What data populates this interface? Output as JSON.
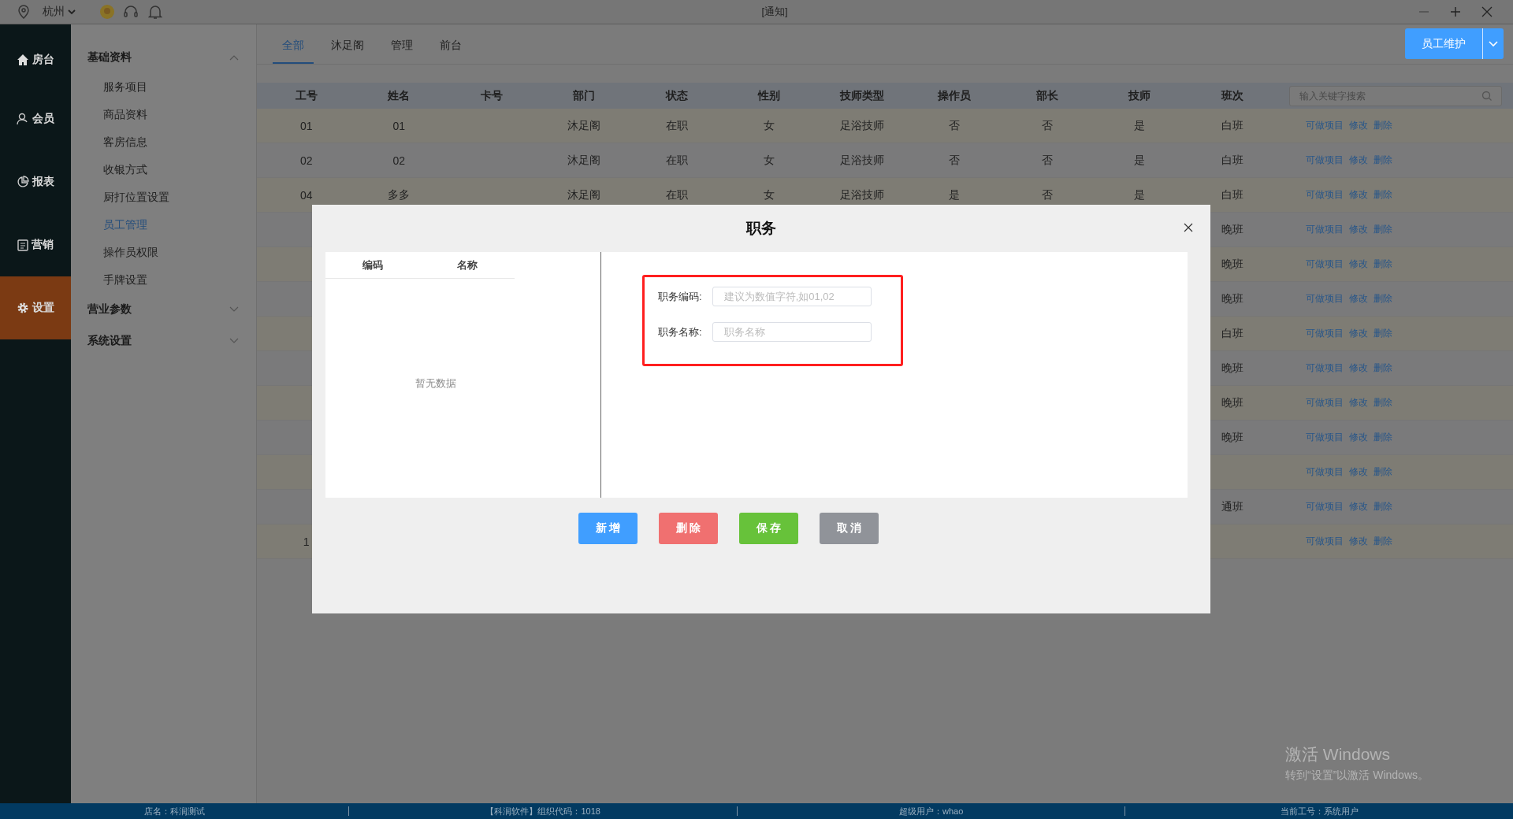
{
  "topbar": {
    "city": "杭州",
    "title": "[通知]"
  },
  "nav": [
    {
      "label": "房台",
      "selected": false
    },
    {
      "label": "会员",
      "selected": false
    },
    {
      "label": "报表",
      "selected": false
    },
    {
      "label": "营销",
      "selected": false
    },
    {
      "label": "设置",
      "selected": true
    }
  ],
  "submenu": [
    {
      "label": "基础资料",
      "expanded": true,
      "children": [
        {
          "label": "服务项目",
          "selected": false
        },
        {
          "label": "商品资料",
          "selected": false
        },
        {
          "label": "客房信息",
          "selected": false
        },
        {
          "label": "收银方式",
          "selected": false
        },
        {
          "label": "厨打位置设置",
          "selected": false
        },
        {
          "label": "员工管理",
          "selected": true
        },
        {
          "label": "操作员权限",
          "selected": false
        },
        {
          "label": "手牌设置",
          "selected": false
        }
      ]
    },
    {
      "label": "营业参数",
      "expanded": false
    },
    {
      "label": "系统设置",
      "expanded": false
    }
  ],
  "tabs": [
    {
      "label": "全部",
      "selected": true
    },
    {
      "label": "沐足阁",
      "selected": false
    },
    {
      "label": "管理",
      "selected": false
    },
    {
      "label": "前台",
      "selected": false
    }
  ],
  "primary_button": {
    "label": "员工维护"
  },
  "table": {
    "columns": [
      "工号",
      "姓名",
      "卡号",
      "部门",
      "状态",
      "性别",
      "技师类型",
      "操作员",
      "部长",
      "技师",
      "班次"
    ],
    "search": {
      "placeholder": "输入关键字搜索"
    },
    "rows": [
      {
        "id": "01",
        "name": "01",
        "department": "沐足阁",
        "status": "在职",
        "gender": "女",
        "tech_type": "足浴技师",
        "operator": "否",
        "manager": "否",
        "technician": "是",
        "shift": "白班",
        "actions": [
          "可做项目",
          "修改",
          "删除"
        ]
      },
      {
        "id": "02",
        "name": "02",
        "department": "沐足阁",
        "status": "在职",
        "gender": "女",
        "tech_type": "足浴技师",
        "operator": "否",
        "manager": "否",
        "technician": "是",
        "shift": "白班",
        "actions": [
          "可做项目",
          "修改",
          "删除"
        ]
      },
      {
        "id": "04",
        "name": "多多",
        "department": "沐足阁",
        "status": "在职",
        "gender": "女",
        "tech_type": "足浴技师",
        "operator": "是",
        "manager": "否",
        "technician": "是",
        "shift": "白班",
        "actions": [
          "可做项目",
          "修改",
          "删除"
        ]
      },
      {
        "shift": "晚班",
        "actions": [
          "可做项目",
          "修改",
          "删除"
        ]
      },
      {
        "shift": "晚班",
        "actions": [
          "可做项目",
          "修改",
          "删除"
        ]
      },
      {
        "shift": "晚班",
        "actions": [
          "可做项目",
          "修改",
          "删除"
        ]
      },
      {
        "shift": "白班",
        "actions": [
          "可做项目",
          "修改",
          "删除"
        ]
      },
      {
        "shift": "晚班",
        "actions": [
          "可做项目",
          "修改",
          "删除"
        ]
      },
      {
        "shift": "晚班",
        "actions": [
          "可做项目",
          "修改",
          "删除"
        ]
      },
      {
        "shift": "晚班",
        "actions": [
          "可做项目",
          "修改",
          "删除"
        ]
      },
      {
        "actions": [
          "可做项目",
          "修改",
          "删除"
        ]
      },
      {
        "shift": "通班",
        "actions": [
          "可做项目",
          "修改",
          "删除"
        ]
      },
      {
        "id": "1",
        "actions": [
          "可做项目",
          "修改",
          "删除"
        ]
      }
    ]
  },
  "modal": {
    "title": "职务",
    "list": {
      "columns": [
        "编码",
        "名称"
      ],
      "empty_text": "暂无数据"
    },
    "form": {
      "highlighted": true,
      "fields": [
        {
          "label": "职务编码:",
          "placeholder": "建议为数值字符,如01,02"
        },
        {
          "label": "职务名称:",
          "placeholder": "职务名称"
        }
      ]
    },
    "buttons": [
      {
        "label": "新 增",
        "kind": "add"
      },
      {
        "label": "删 除",
        "kind": "delete"
      },
      {
        "label": "保 存",
        "kind": "save"
      },
      {
        "label": "取 消",
        "kind": "cancel"
      }
    ]
  },
  "status_bar": [
    "店名：科润测试",
    "【科润软件】组织代码：1018",
    "超级用户：whao",
    "当前工号：系统用户"
  ],
  "activation_notice": {
    "title": "激活 Windows",
    "text": "转到“设置”以激活 Windows。"
  }
}
